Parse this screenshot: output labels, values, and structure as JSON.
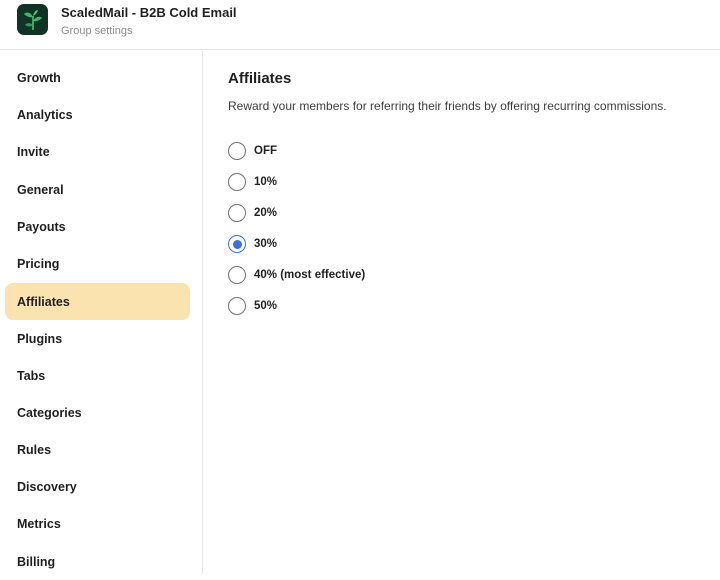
{
  "header": {
    "app_title": "ScaledMail - B2B Cold Email",
    "subtitle": "Group settings"
  },
  "sidebar": {
    "items": [
      {
        "label": "Growth",
        "active": false
      },
      {
        "label": "Analytics",
        "active": false
      },
      {
        "label": "Invite",
        "active": false
      },
      {
        "label": "General",
        "active": false
      },
      {
        "label": "Payouts",
        "active": false
      },
      {
        "label": "Pricing",
        "active": false
      },
      {
        "label": "Affiliates",
        "active": true
      },
      {
        "label": "Plugins",
        "active": false
      },
      {
        "label": "Tabs",
        "active": false
      },
      {
        "label": "Categories",
        "active": false
      },
      {
        "label": "Rules",
        "active": false
      },
      {
        "label": "Discovery",
        "active": false
      },
      {
        "label": "Metrics",
        "active": false
      },
      {
        "label": "Billing",
        "active": false
      }
    ]
  },
  "main": {
    "title": "Affiliates",
    "description": "Reward your members for referring their friends by offering recurring commissions.",
    "options": [
      {
        "label": "OFF",
        "checked": false
      },
      {
        "label": "10%",
        "checked": false
      },
      {
        "label": "20%",
        "checked": false
      },
      {
        "label": "30%",
        "checked": true
      },
      {
        "label": "40% (most effective)",
        "checked": false
      },
      {
        "label": "50%",
        "checked": false
      }
    ]
  },
  "colors": {
    "accent": "#3b6fe0",
    "active_nav_bg": "#fbe3b0",
    "logo_bg": "#0f3324",
    "logo_leaf": "#3fb56a"
  },
  "icons": {
    "logo": "sprout-logo-icon"
  }
}
